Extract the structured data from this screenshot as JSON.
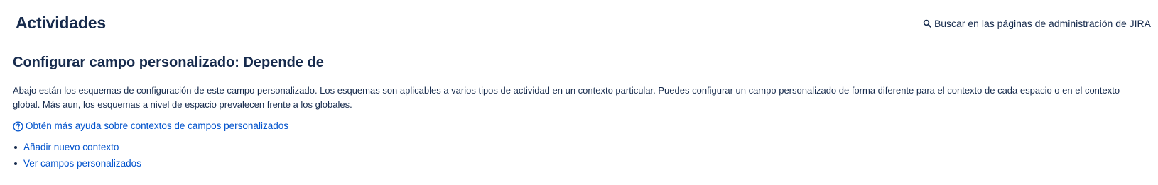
{
  "header": {
    "title": "Actividades",
    "admin_search_label": "Buscar en las páginas de administración de JIRA",
    "admin_search_icon": "search-icon"
  },
  "main": {
    "section_title": "Configurar campo personalizado: Depende de",
    "description": "Abajo están los esquemas de configuración de este campo personalizado. Los esquemas son aplicables a varios tipos de actividad en un contexto particular. Puedes configurar un campo personalizado de forma diferente para el contexto de cada espacio o en el contexto global. Más aun, los esquemas a nivel de espacio prevalecen frente a los globales.",
    "help_link": {
      "label": "Obtén más ayuda sobre contextos de campos personalizados",
      "icon": "help-circle-icon"
    },
    "actions": [
      {
        "label": "Añadir nuevo contexto"
      },
      {
        "label": "Ver campos personalizados"
      }
    ]
  },
  "colors": {
    "text": "#172b4d",
    "link": "#0052cc",
    "background": "#ffffff"
  }
}
